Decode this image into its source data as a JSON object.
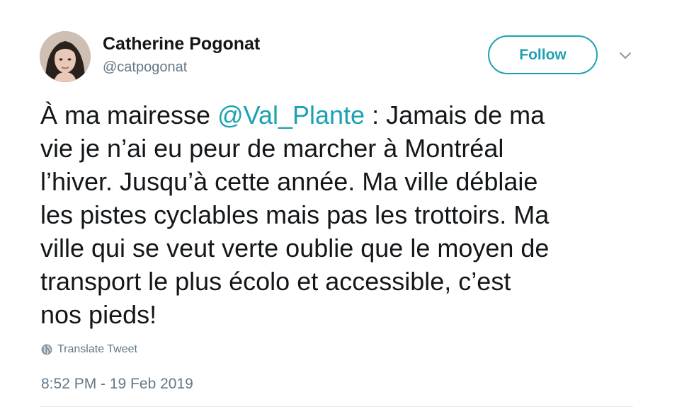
{
  "author": {
    "name": "Catherine Pogonat",
    "handle": "@catpogonat"
  },
  "actions": {
    "follow_label": "Follow",
    "menu_icon": "chevron-down-icon"
  },
  "tweet": {
    "lines": [
      {
        "before": "À ma mairesse ",
        "mention": "@Val_Plante",
        "after": " : Jamais de ma"
      },
      {
        "text": "vie je n’ai eu peur de marcher à Montréal"
      },
      {
        "text": "l’hiver. Jusqu’à cette année. Ma ville déblaie"
      },
      {
        "text": "les pistes cyclables mais pas les trottoirs. Ma"
      },
      {
        "text": "ville qui se veut verte oublie que le moyen de"
      },
      {
        "text": "transport le plus écolo et accessible, c’est"
      },
      {
        "text": "nos pieds!"
      }
    ],
    "translate_label": "Translate Tweet",
    "timestamp": "8:52 PM - 19 Feb 2019"
  },
  "colors": {
    "accent": "#1da1b2",
    "text": "#14171a",
    "muted": "#657786",
    "divider": "#e6ecf0"
  }
}
